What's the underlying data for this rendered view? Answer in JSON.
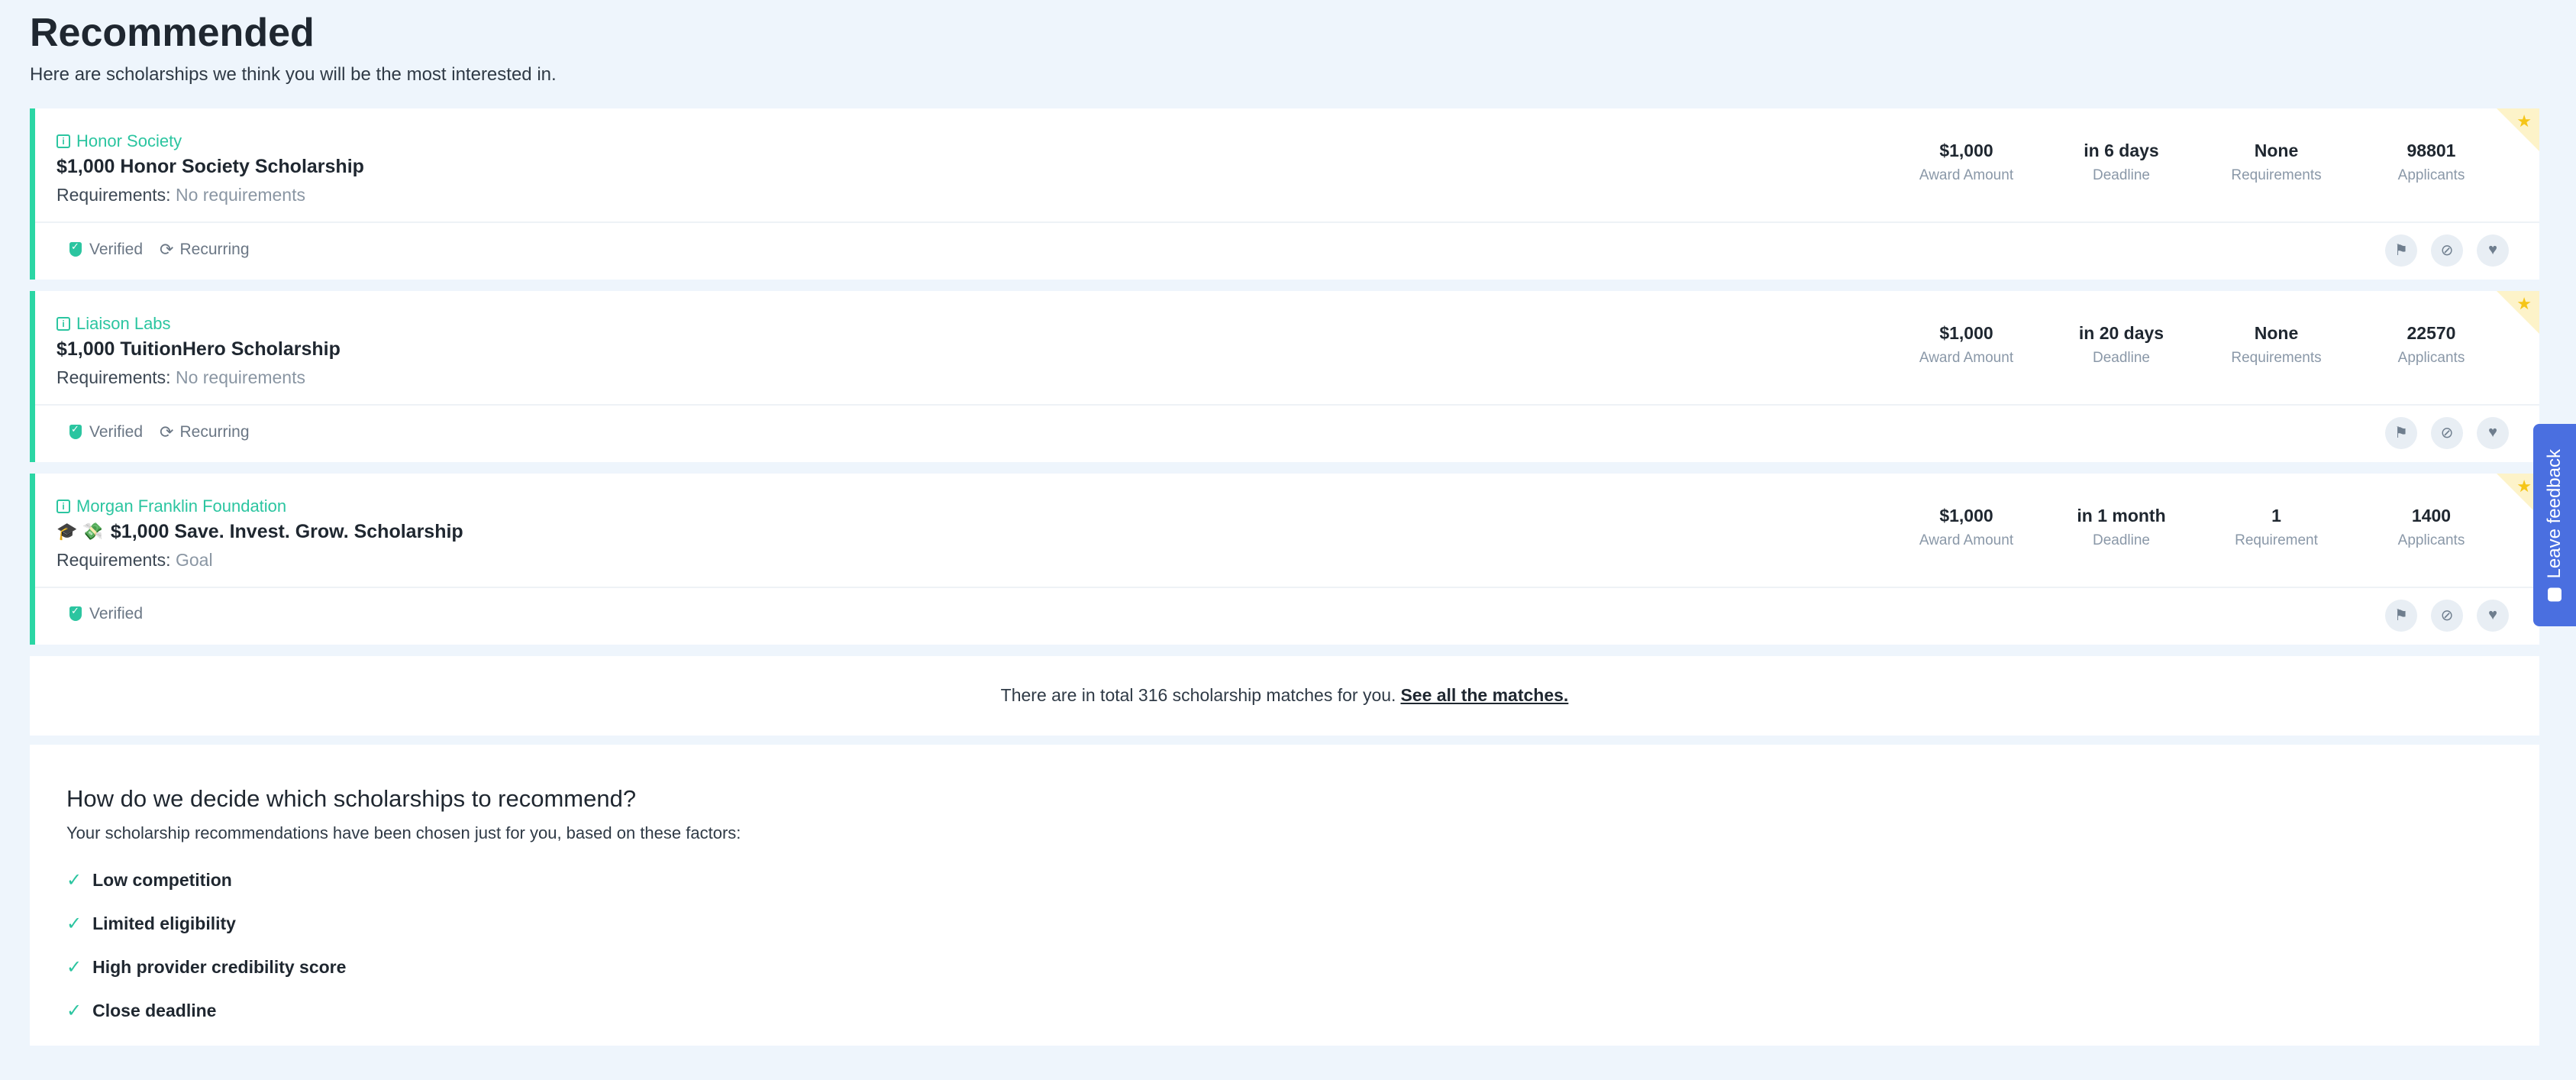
{
  "header": {
    "title": "Recommended",
    "subtitle": "Here are scholarships we think you will be the most interested in."
  },
  "scholarships": [
    {
      "provider": "Honor Society",
      "name": "$1,000 Honor Society Scholarship",
      "emoji": "",
      "requirements_label": "Requirements:",
      "requirements_value": "No requirements",
      "stats": [
        {
          "value": "$1,000",
          "label": "Award Amount"
        },
        {
          "value": "in 6 days",
          "label": "Deadline"
        },
        {
          "value": "None",
          "label": "Requirements"
        },
        {
          "value": "98801",
          "label": "Applicants"
        }
      ],
      "verified_label": "Verified",
      "recurring_label": "Recurring"
    },
    {
      "provider": "Liaison Labs",
      "name": "$1,000 TuitionHero Scholarship",
      "emoji": "",
      "requirements_label": "Requirements:",
      "requirements_value": "No requirements",
      "stats": [
        {
          "value": "$1,000",
          "label": "Award Amount"
        },
        {
          "value": "in 20 days",
          "label": "Deadline"
        },
        {
          "value": "None",
          "label": "Requirements"
        },
        {
          "value": "22570",
          "label": "Applicants"
        }
      ],
      "verified_label": "Verified",
      "recurring_label": "Recurring"
    },
    {
      "provider": "Morgan Franklin Foundation",
      "name": "$1,000 Save. Invest. Grow. Scholarship",
      "emoji": "🎓 💸",
      "requirements_label": "Requirements:",
      "requirements_value": "Goal",
      "stats": [
        {
          "value": "$1,000",
          "label": "Award Amount"
        },
        {
          "value": "in 1 month",
          "label": "Deadline"
        },
        {
          "value": "1",
          "label": "Requirement"
        },
        {
          "value": "1400",
          "label": "Applicants"
        }
      ],
      "verified_label": "Verified",
      "recurring_label": ""
    }
  ],
  "matches": {
    "text": "There are in total 316 scholarship matches for you.",
    "link": "See all the matches."
  },
  "info": {
    "heading": "How do we decide which scholarships to recommend?",
    "description": "Your scholarship recommendations have been chosen just for you, based on these factors:",
    "factors": [
      "Low competition",
      "Limited eligibility",
      "High provider credibility score",
      "Close deadline"
    ]
  },
  "feedback": {
    "label": "Leave feedback"
  },
  "colors": {
    "accent": "#2bd6a4",
    "feedback": "#4a6fe0",
    "star": "#f5c518"
  }
}
